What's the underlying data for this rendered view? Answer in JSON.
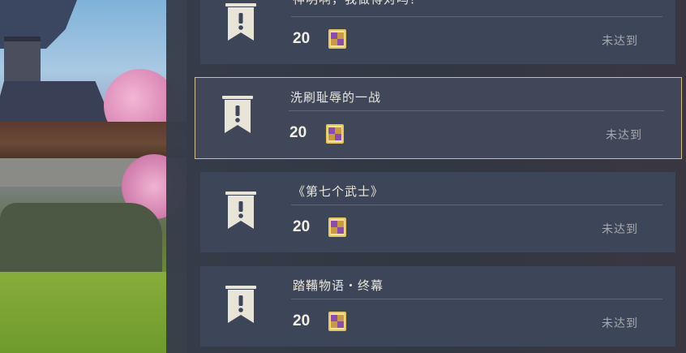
{
  "achievements": [
    {
      "title": "神明啊，我做得对吗？",
      "reward_count": "20",
      "status": "未达到",
      "reward_icon": "primogem-icon",
      "badge_icon": "exclamation-banner-icon"
    },
    {
      "title": "洗刷耻辱的一战",
      "reward_count": "20",
      "status": "未达到",
      "reward_icon": "primogem-icon",
      "badge_icon": "exclamation-banner-icon",
      "selected": true
    },
    {
      "title": "《第七个武士》",
      "reward_count": "20",
      "status": "未达到",
      "reward_icon": "primogem-icon",
      "badge_icon": "exclamation-banner-icon"
    },
    {
      "title": "踏鞴物语・终幕",
      "reward_count": "20",
      "status": "未达到",
      "reward_icon": "primogem-icon",
      "badge_icon": "exclamation-banner-icon"
    }
  ],
  "colors": {
    "card_bg": "#3d4659",
    "selected_border": "#d4bd86",
    "title_text": "#e9e5dc",
    "status_text": "#a8a9ad"
  }
}
